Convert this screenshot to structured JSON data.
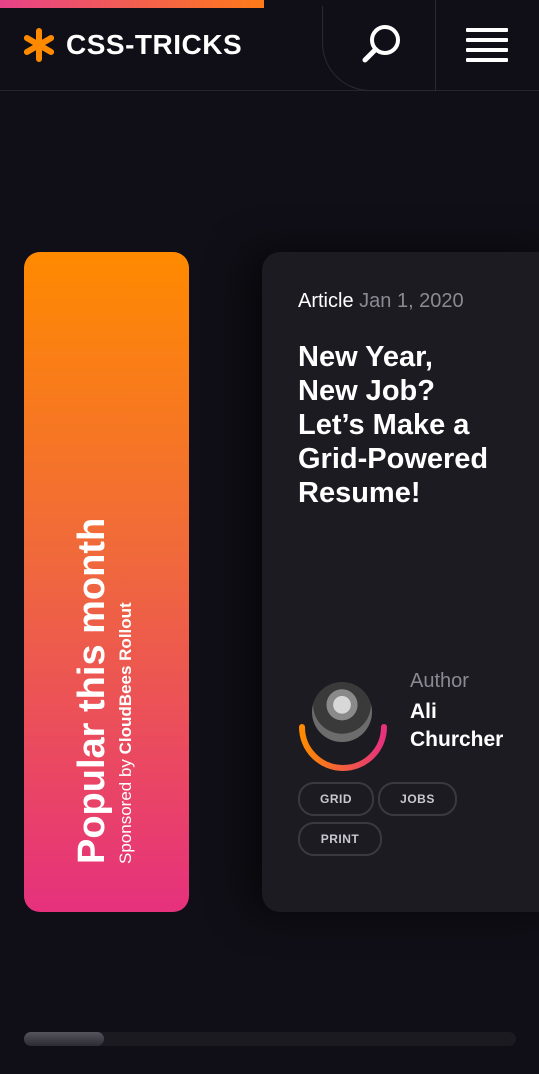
{
  "site": {
    "logo_text": "CSS-TRICKS"
  },
  "header": {
    "progress": 0.49
  },
  "popular": {
    "title": "Popular this month",
    "sponsor_prefix": "Sponsored by ",
    "sponsor_name": "CloudBees Rollout"
  },
  "article": {
    "type": "Article",
    "date": "Jan 1, 2020",
    "title": "New Year,\nNew Job?\nLet’s Make a\nGrid-Powered\nResume!",
    "author_label": "Author",
    "author_name": "Ali Churcher",
    "tags": [
      "GRID",
      "JOBS",
      "PRINT"
    ]
  },
  "colors": {
    "accent_orange": "#ff8a00",
    "accent_pink": "#e6317d",
    "background": "#100f17",
    "card": "#1c1b22"
  },
  "icons": [
    "asterisk-logo-icon",
    "search-icon",
    "hamburger-menu-icon"
  ]
}
